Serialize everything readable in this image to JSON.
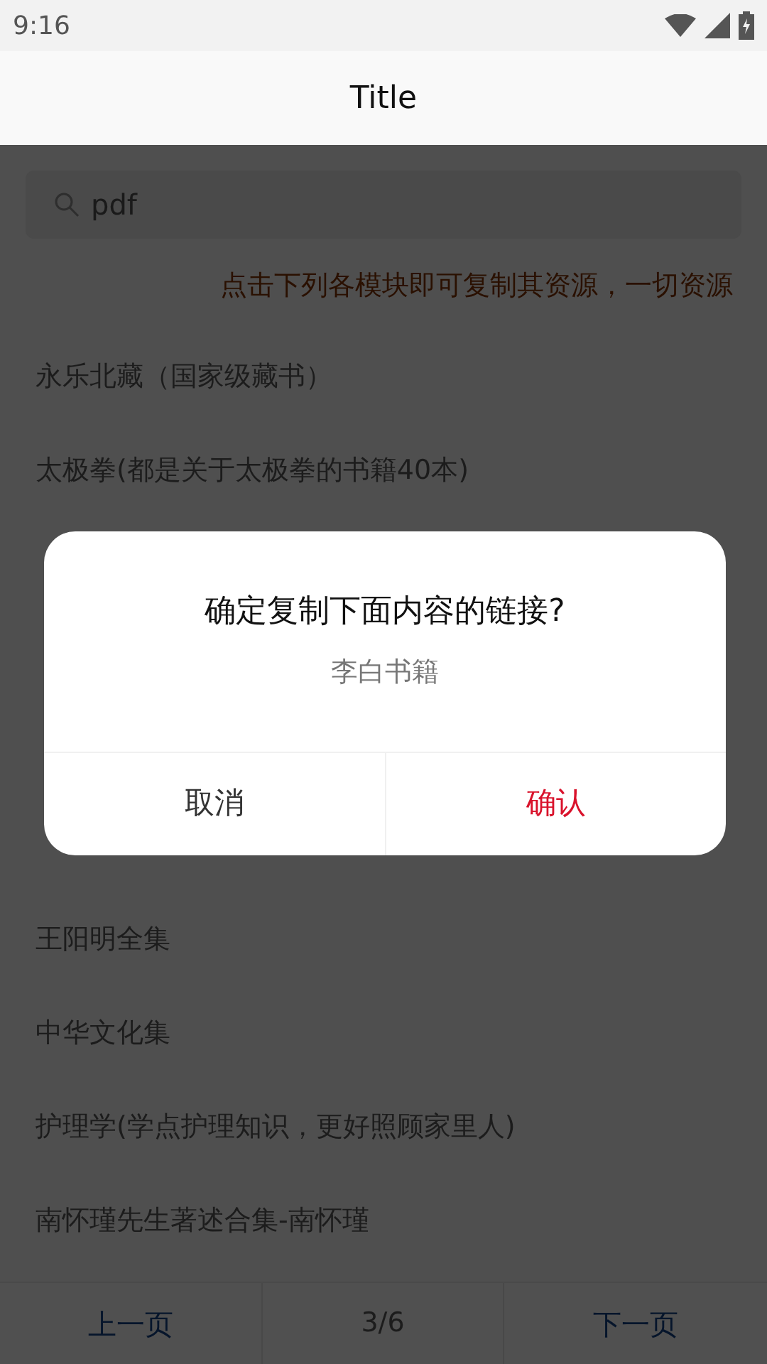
{
  "status_bar": {
    "time": "9:16"
  },
  "title_bar": {
    "title": "Title"
  },
  "search": {
    "value": "pdf"
  },
  "notice": "点击下列各模块即可复制其资源，一切资源",
  "items_above": [
    "永乐北藏（国家级藏书）",
    "太极拳(都是关于太极拳的书籍40本)"
  ],
  "items_below": [
    "王阳明全集",
    "中华文化集",
    "护理学(学点护理知识，更好照顾家里人)",
    "南怀瑾先生著述合集-南怀瑾"
  ],
  "pager": {
    "prev": "上一页",
    "page": "3/6",
    "next": "下一页"
  },
  "dialog": {
    "title": "确定复制下面内容的链接?",
    "message": "李白书籍",
    "buttons": [
      {
        "label": "取消",
        "kind": "cancel"
      },
      {
        "label": "确认",
        "kind": "confirm"
      }
    ]
  }
}
